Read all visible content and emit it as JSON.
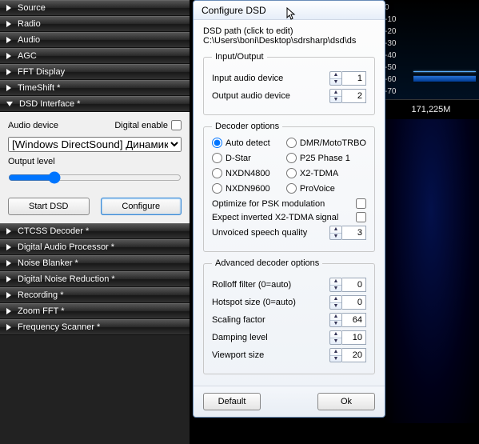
{
  "sidebar": {
    "top_items": [
      {
        "label": "Source"
      },
      {
        "label": "Radio"
      },
      {
        "label": "Audio"
      },
      {
        "label": "AGC"
      },
      {
        "label": "FFT Display"
      },
      {
        "label": "TimeShift *"
      }
    ],
    "expanded_item": {
      "label": "DSD Interface *"
    },
    "bottom_items": [
      {
        "label": "CTCSS Decoder *"
      },
      {
        "label": "Digital Audio Processor *"
      },
      {
        "label": "Noise Blanker *"
      },
      {
        "label": "Digital Noise Reduction *"
      },
      {
        "label": "Recording *"
      },
      {
        "label": "Zoom FFT *"
      },
      {
        "label": "Frequency Scanner *"
      }
    ]
  },
  "dsd_panel": {
    "audio_device_label": "Audio device",
    "digital_enable_label": "Digital enable",
    "audio_device_value": "[Windows DirectSound] Динамики (Ус",
    "output_level_label": "Output level",
    "start_btn": "Start DSD",
    "configure_btn": "Configure"
  },
  "spectrum": {
    "ticks": [
      "0",
      "-10",
      "-20",
      "-30",
      "-40",
      "-50",
      "-60",
      "-70"
    ],
    "freq": "171,225M"
  },
  "dialog": {
    "title": "Configure DSD",
    "path_label": "DSD path (click to edit)",
    "path_value": "C:\\Users\\boni\\Desktop\\sdrsharp\\dsd\\ds",
    "io": {
      "legend": "Input/Output",
      "input_label": "Input audio device",
      "input_value": "1",
      "output_label": "Output audio device",
      "output_value": "2"
    },
    "decoder": {
      "legend": "Decoder options",
      "radios": [
        {
          "label": "Auto detect",
          "checked": true
        },
        {
          "label": "DMR/MotoTRBO",
          "checked": false
        },
        {
          "label": "D-Star",
          "checked": false
        },
        {
          "label": "P25 Phase 1",
          "checked": false
        },
        {
          "label": "NXDN4800",
          "checked": false
        },
        {
          "label": "X2-TDMA",
          "checked": false
        },
        {
          "label": "NXDN9600",
          "checked": false
        },
        {
          "label": "ProVoice",
          "checked": false
        }
      ],
      "psk_label": "Optimize for PSK modulation",
      "x2_label": "Expect inverted X2-TDMA signal",
      "unvoiced_label": "Unvoiced speech quality",
      "unvoiced_value": "3"
    },
    "advanced": {
      "legend": "Advanced decoder options",
      "rolloff_label": "Rolloff filter (0=auto)",
      "rolloff_value": "0",
      "hotspot_label": "Hotspot size (0=auto)",
      "hotspot_value": "0",
      "scaling_label": "Scaling factor",
      "scaling_value": "64",
      "damping_label": "Damping level",
      "damping_value": "10",
      "viewport_label": "Viewport size",
      "viewport_value": "20"
    },
    "default_btn": "Default",
    "ok_btn": "Ok"
  }
}
